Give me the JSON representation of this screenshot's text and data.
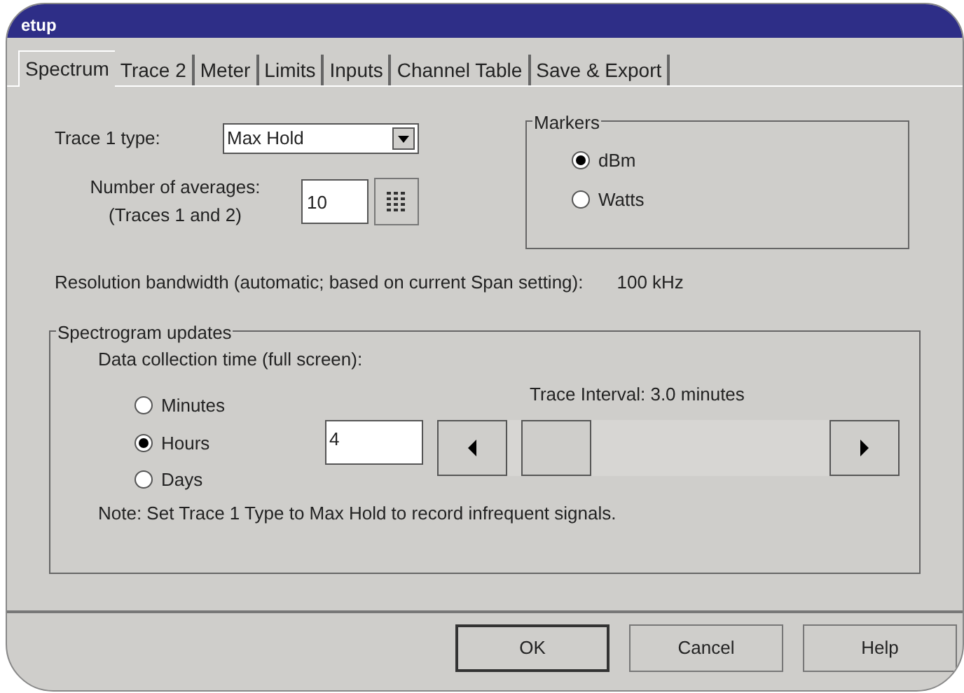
{
  "window": {
    "title": "etup"
  },
  "tabs": [
    {
      "label": "Spectrum",
      "selected": true
    },
    {
      "label": "Trace 2",
      "selected": false
    },
    {
      "label": "Meter",
      "selected": false
    },
    {
      "label": "Limits",
      "selected": false
    },
    {
      "label": "Inputs",
      "selected": false
    },
    {
      "label": "Channel Table",
      "selected": false
    },
    {
      "label": "Save & Export",
      "selected": false
    }
  ],
  "trace_type": {
    "label": "Trace 1 type:",
    "value": "Max Hold"
  },
  "averages": {
    "label": "Number of averages:",
    "sublabel": "(Traces 1 and 2)",
    "value": "10"
  },
  "markers": {
    "title": "Markers",
    "options": [
      {
        "label": "dBm",
        "selected": true
      },
      {
        "label": "Watts",
        "selected": false
      }
    ]
  },
  "resolution": {
    "label": "Resolution bandwidth (automatic; based on current Span setting):",
    "value": "100 kHz"
  },
  "spectrogram": {
    "title": "Spectrogram updates",
    "collection_label": "Data collection time (full screen):",
    "units": [
      {
        "label": "Minutes",
        "selected": false
      },
      {
        "label": "Hours",
        "selected": true
      },
      {
        "label": "Days",
        "selected": false
      }
    ],
    "value": "4",
    "interval": "Trace Interval: 3.0 minutes",
    "note": "Note: Set Trace 1 Type to Max Hold to record infrequent signals."
  },
  "buttons": [
    {
      "label": "OK",
      "default": true
    },
    {
      "label": "Cancel",
      "default": false
    },
    {
      "label": "Help",
      "default": false
    }
  ]
}
